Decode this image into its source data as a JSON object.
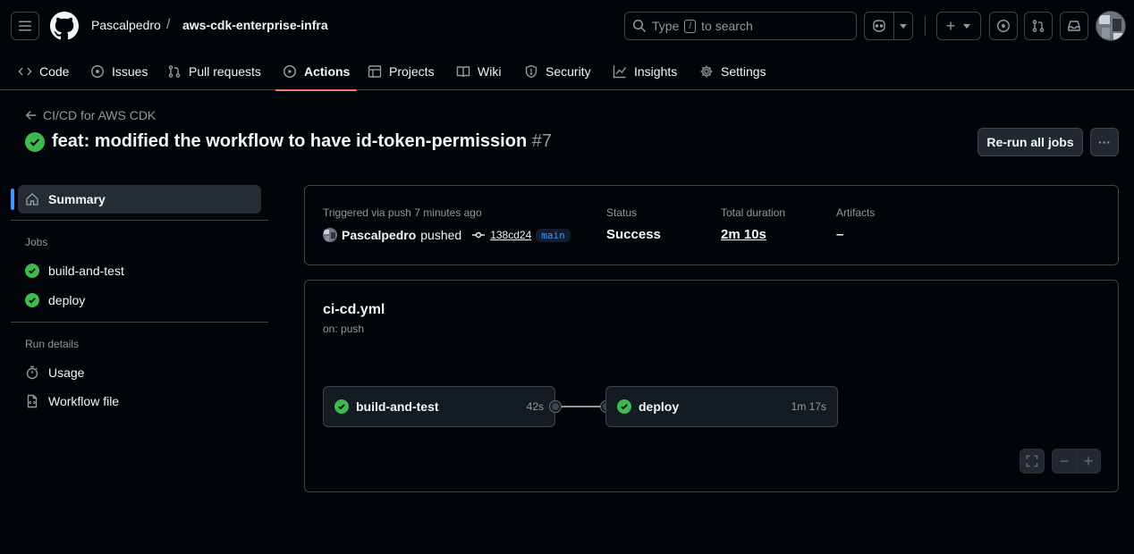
{
  "header": {
    "owner": "Pascalpedro",
    "separator": "/",
    "repo": "aws-cdk-enterprise-infra",
    "search": {
      "prefix": "Type",
      "key": "/",
      "suffix": "to search"
    },
    "plus_label": "+"
  },
  "nav": {
    "tabs": [
      {
        "label": "Code",
        "icon": "code-icon"
      },
      {
        "label": "Issues",
        "icon": "issue-icon"
      },
      {
        "label": "Pull requests",
        "icon": "pull-request-icon"
      },
      {
        "label": "Actions",
        "icon": "play-icon",
        "active": true
      },
      {
        "label": "Projects",
        "icon": "table-icon"
      },
      {
        "label": "Wiki",
        "icon": "book-icon"
      },
      {
        "label": "Security",
        "icon": "shield-icon"
      },
      {
        "label": "Insights",
        "icon": "graph-icon"
      },
      {
        "label": "Settings",
        "icon": "gear-icon"
      }
    ]
  },
  "run": {
    "back_label": "CI/CD for AWS CDK",
    "title": "feat: modified the workflow to have id-token-permission",
    "number": "#7",
    "rerun_label": "Re-run all jobs",
    "more_label": "···"
  },
  "sidebar": {
    "summary": "Summary",
    "jobs_heading": "Jobs",
    "jobs": [
      "build-and-test",
      "deploy"
    ],
    "details_heading": "Run details",
    "details": [
      {
        "label": "Usage",
        "icon": "stopwatch-icon"
      },
      {
        "label": "Workflow file",
        "icon": "file-code-icon"
      }
    ]
  },
  "summary": {
    "trigger": "Triggered via push 7 minutes ago",
    "actor": "Pascalpedro",
    "action": "pushed",
    "commit": "138cd24",
    "branch": "main",
    "status_label": "Status",
    "status_value": "Success",
    "duration_label": "Total duration",
    "duration_value": "2m 10s",
    "artifacts_label": "Artifacts",
    "artifacts_value": "–"
  },
  "workflow": {
    "file": "ci-cd.yml",
    "on": "on: push",
    "jobs": [
      {
        "name": "build-and-test",
        "duration": "42s"
      },
      {
        "name": "deploy",
        "duration": "1m 17s"
      }
    ],
    "zoom_out": "−",
    "zoom_in": "+"
  },
  "colors": {
    "success": "#3fb950",
    "accent": "#f78166",
    "link": "#4493f8"
  }
}
